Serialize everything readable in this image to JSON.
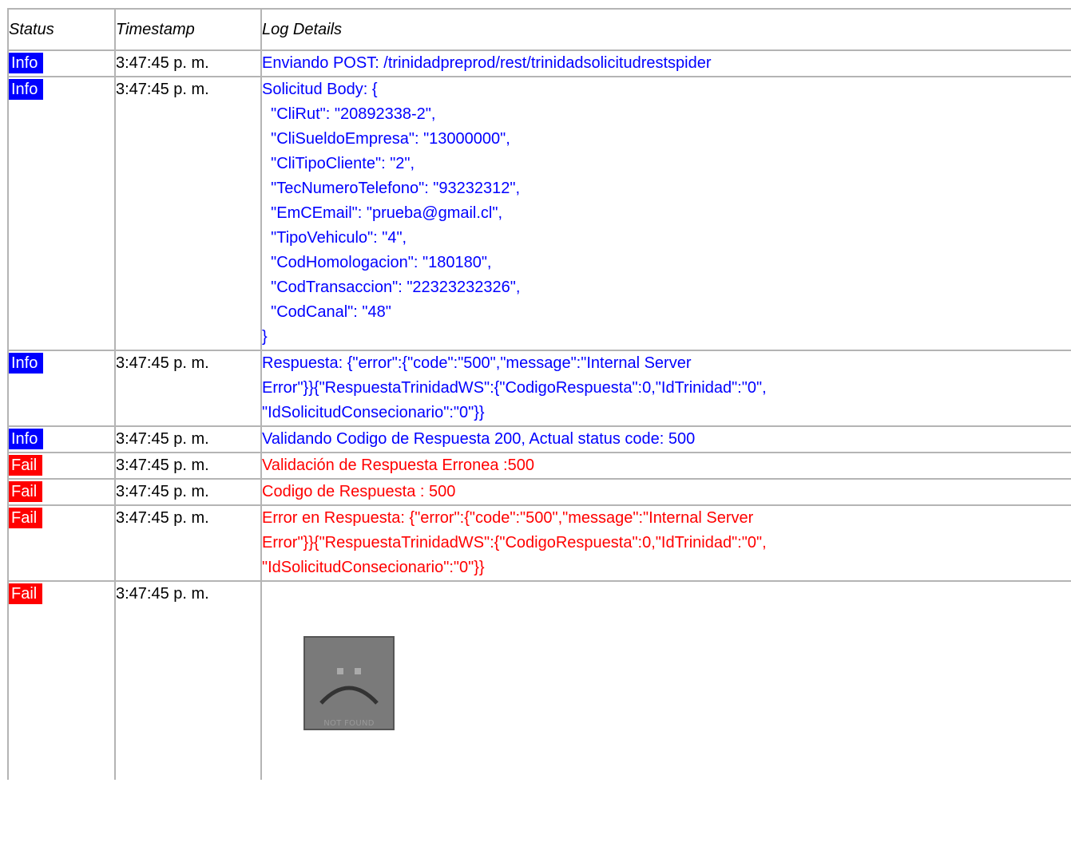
{
  "headers": {
    "status": "Status",
    "timestamp": "Timestamp",
    "details": "Log Details"
  },
  "colors": {
    "info": "#0000ff",
    "fail": "#ff0000",
    "border": "#b4b4b4"
  },
  "rows": [
    {
      "status": "Info",
      "timestamp": "3:47:45 p. m.",
      "details": "Enviando POST: /trinidadpreprod/rest/trinidadsolicitudrestspider"
    },
    {
      "status": "Info",
      "timestamp": "3:47:45 p. m.",
      "details": "Solicitud Body: {\n  \"CliRut\": \"20892338-2\",\n  \"CliSueldoEmpresa\": \"13000000\",\n  \"CliTipoCliente\": \"2\",\n  \"TecNumeroTelefono\": \"93232312\",\n  \"EmCEmail\": \"prueba@gmail.cl\",\n  \"TipoVehiculo\": \"4\",\n  \"CodHomologacion\": \"180180\",\n  \"CodTransaccion\": \"22323232326\",\n  \"CodCanal\": \"48\"\n}"
    },
    {
      "status": "Info",
      "timestamp": "3:47:45 p. m.",
      "details": "Respuesta: {\"error\":{\"code\":\"500\",\"message\":\"Internal Server\nError\"}}{\"RespuestaTrinidadWS\":{\"CodigoRespuesta\":0,\"IdTrinidad\":\"0\",\n\"IdSolicitudConsecionario\":\"0\"}}"
    },
    {
      "status": "Info",
      "timestamp": "3:47:45 p. m.",
      "details": "Validando Codigo de Respuesta 200, Actual status code: 500"
    },
    {
      "status": "Fail",
      "timestamp": "3:47:45 p. m.",
      "details": "Validación de Respuesta Erronea :500"
    },
    {
      "status": "Fail",
      "timestamp": "3:47:45 p. m.",
      "details": "Codigo de Respuesta : 500"
    },
    {
      "status": "Fail",
      "timestamp": "3:47:45 p. m.",
      "details": "Error en Respuesta: {\"error\":{\"code\":\"500\",\"message\":\"Internal Server\nError\"}}{\"RespuestaTrinidadWS\":{\"CodigoRespuesta\":0,\"IdTrinidad\":\"0\",\n\"IdSolicitudConsecionario\":\"0\"}}"
    },
    {
      "status": "Fail",
      "timestamp": "3:47:45 p. m.",
      "image": {
        "icon": "not-found-image-icon",
        "label": "NOT FOUND"
      }
    }
  ]
}
